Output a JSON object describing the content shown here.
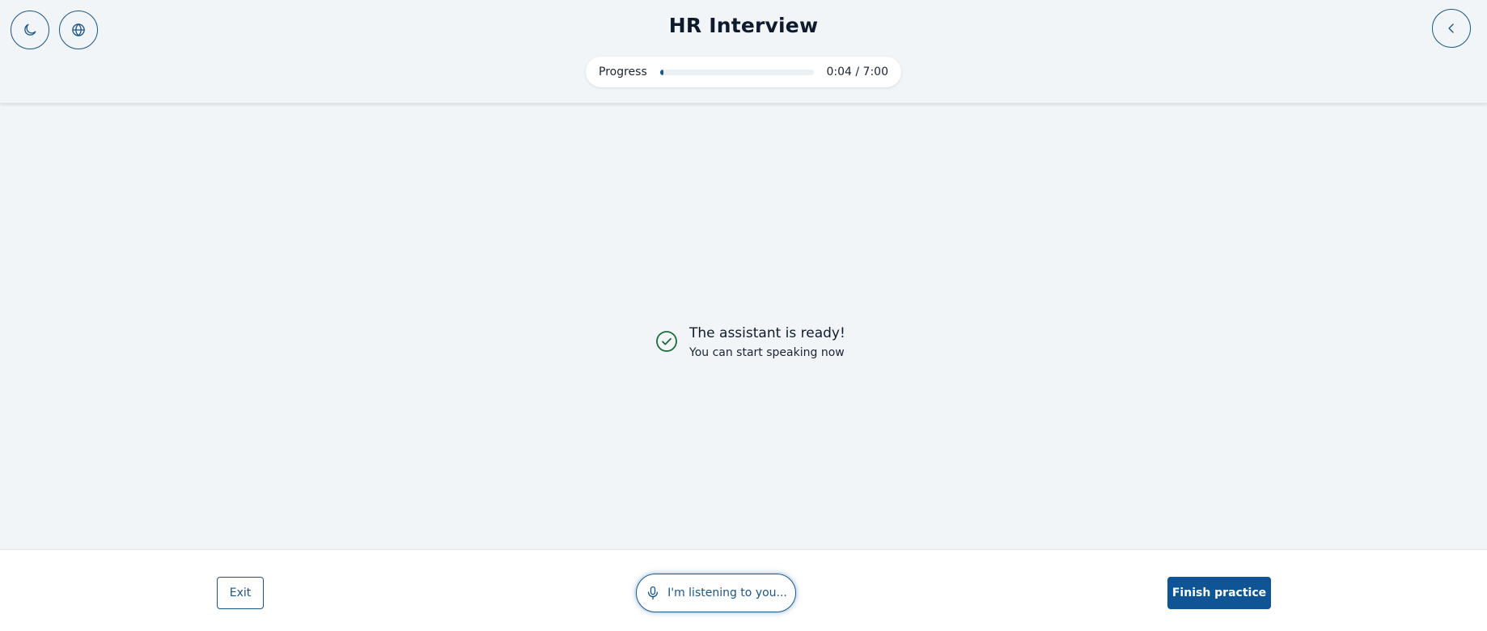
{
  "header": {
    "title": "HR Interview",
    "theme_button": {
      "icon": "moon-icon"
    },
    "language_button": {
      "icon": "globe-icon"
    },
    "back_button": {
      "icon": "chevron-left-icon"
    }
  },
  "progress": {
    "label": "Progress",
    "time_text": "0:04 / 7:00",
    "fraction": 0.0095,
    "fill_color": "#1b5587"
  },
  "status": {
    "icon": "check-circle-icon",
    "title": "The assistant is ready!",
    "subtitle": "You can start speaking now",
    "color": "#1c6b36"
  },
  "footer": {
    "exit_label": "Exit",
    "listening_label": "I'm listening to you...",
    "listening_icon": "microphone-icon",
    "finish_label": "Finish practice"
  },
  "colors": {
    "accent": "#1b5587",
    "primary_button": "#0f5595",
    "background": "#f1f5f8",
    "success": "#1c6b36"
  }
}
